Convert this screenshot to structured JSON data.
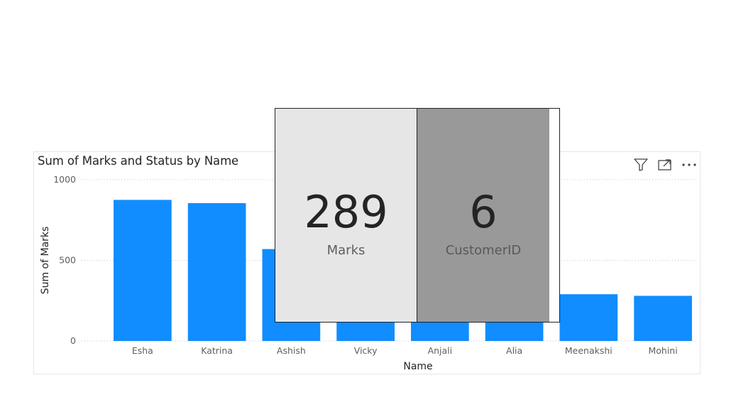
{
  "visual": {
    "title": "Sum of Marks and Status by Name",
    "icons": [
      "filter-icon",
      "focus-mode-icon",
      "more-options-icon"
    ]
  },
  "chart_data": {
    "type": "bar",
    "title": "Sum of Marks and Status by Name",
    "xlabel": "Name",
    "ylabel": "Sum of Marks",
    "categories": [
      "Esha",
      "Katrina",
      "Ashish",
      "Vicky",
      "Anjali",
      "Alia",
      "Meenakshi",
      "Mohini"
    ],
    "values": [
      875,
      855,
      570,
      450,
      430,
      420,
      290,
      280
    ],
    "ylim": [
      0,
      1000
    ],
    "yticks": [
      "0",
      "500",
      "1000"
    ],
    "grid": true,
    "bar_color": "#118dff"
  },
  "cards": [
    {
      "value": "289",
      "label": "Marks",
      "background": "#e6e6e6"
    },
    {
      "value": "6",
      "label": "CustomerID",
      "background": "#999999"
    }
  ]
}
